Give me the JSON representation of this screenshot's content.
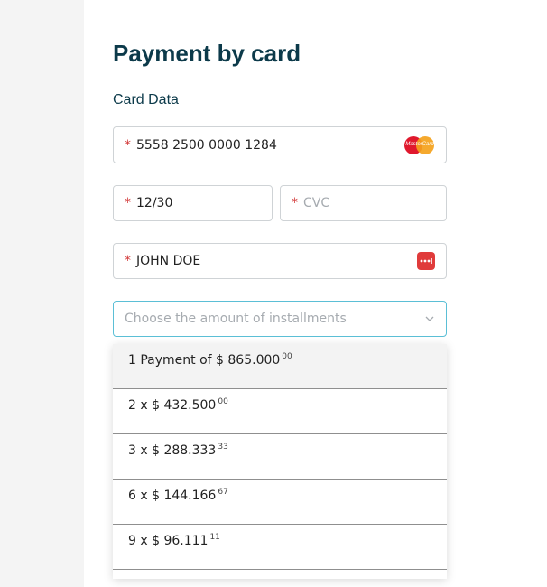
{
  "page": {
    "title": "Payment by card",
    "section_label": "Card Data"
  },
  "form": {
    "required_marker": "*",
    "card_number": {
      "value": "5558 2500 0000 1284",
      "brand_icon": "mastercard-icon",
      "brand_text": "MasterCard"
    },
    "expiry": {
      "value": "12/30"
    },
    "cvc": {
      "placeholder": "CVC"
    },
    "name": {
      "value": "JOHN DOE",
      "icon": "autofill-key-icon"
    },
    "installments": {
      "placeholder": "Choose the amount of installments",
      "icon": "chevron-down-icon"
    }
  },
  "dropdown": {
    "options": [
      {
        "main": "1 Payment of $ 865.000",
        "cents": "00",
        "selected": true
      },
      {
        "main": "2 x $ 432.500",
        "cents": "00",
        "selected": false
      },
      {
        "main": "3 x $ 288.333",
        "cents": "33",
        "selected": false
      },
      {
        "main": "6 x $ 144.166",
        "cents": "67",
        "selected": false
      },
      {
        "main": "9 x $ 96.111",
        "cents": "11",
        "selected": false
      }
    ]
  },
  "colors": {
    "title": "#0c3a4a",
    "required": "#d33a3a",
    "focus_border": "#5bbfd6",
    "autofill_icon": "#e03b3b"
  }
}
